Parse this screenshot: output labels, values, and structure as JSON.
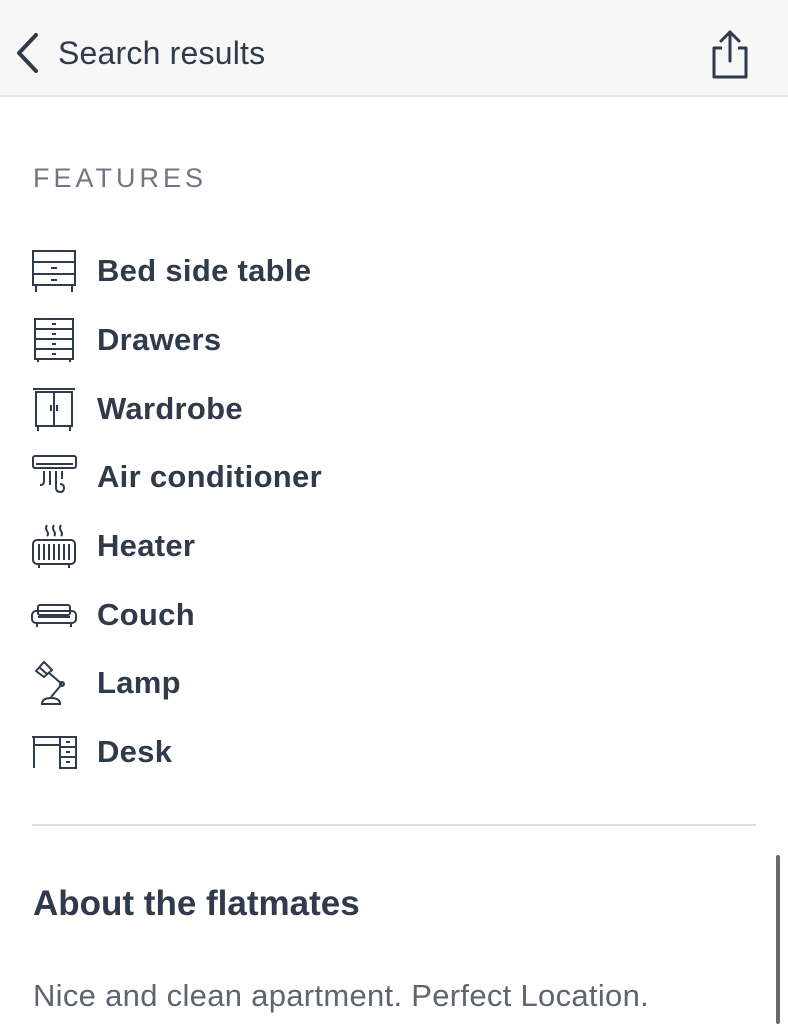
{
  "header": {
    "back_label": "Search results",
    "back_icon": "chevron-left-icon",
    "share_icon": "share-icon"
  },
  "features": {
    "heading": "FEATURES",
    "items": [
      {
        "label": "Bed side table",
        "icon": "bedside-table-icon"
      },
      {
        "label": "Drawers",
        "icon": "drawers-icon"
      },
      {
        "label": "Wardrobe",
        "icon": "wardrobe-icon"
      },
      {
        "label": "Air conditioner",
        "icon": "air-conditioner-icon"
      },
      {
        "label": "Heater",
        "icon": "heater-icon"
      },
      {
        "label": "Couch",
        "icon": "couch-icon"
      },
      {
        "label": "Lamp",
        "icon": "lamp-icon"
      },
      {
        "label": "Desk",
        "icon": "desk-icon"
      }
    ]
  },
  "about": {
    "title": "About the flatmates",
    "text": "Nice and clean apartment. Perfect Location."
  },
  "colors": {
    "text": "#2f3a4a",
    "muted": "#6f7681",
    "header_bg": "#f7f7f7"
  }
}
